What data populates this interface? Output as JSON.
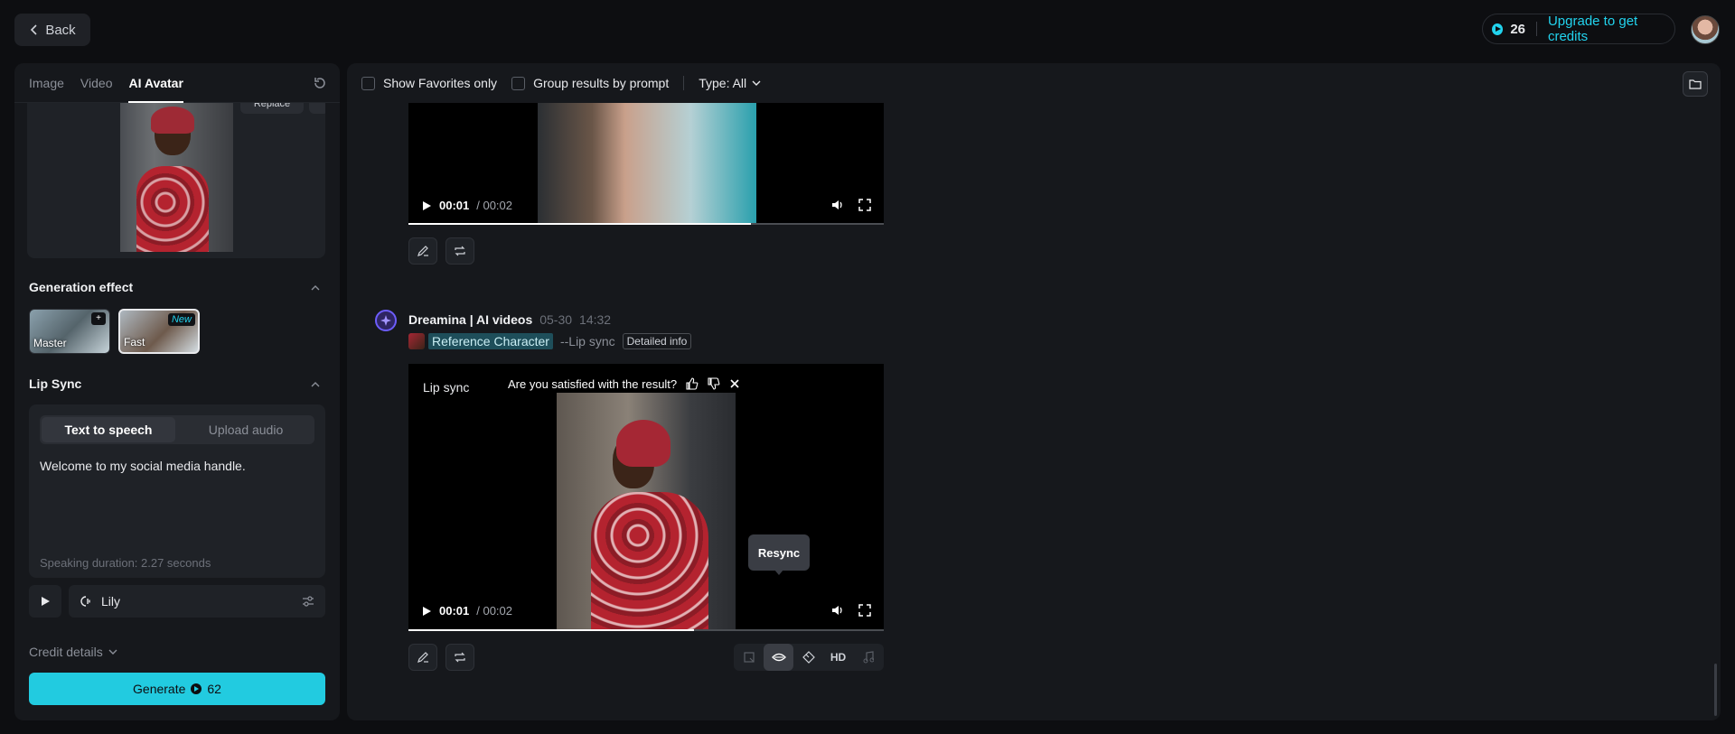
{
  "top": {
    "back_label": "Back",
    "credits": "26",
    "upgrade_label": "Upgrade to get credits"
  },
  "left": {
    "tabs": [
      {
        "label": "Image"
      },
      {
        "label": "Video"
      },
      {
        "label": "AI Avatar"
      }
    ],
    "replace_label": "Replace",
    "generation_effect": {
      "title": "Generation effect",
      "options": [
        {
          "label": "Master",
          "badge": "+"
        },
        {
          "label": "Fast",
          "badge": "New"
        }
      ]
    },
    "lip_sync": {
      "title": "Lip Sync",
      "modes": [
        {
          "label": "Text to speech"
        },
        {
          "label": "Upload audio"
        }
      ],
      "text": "Welcome to my social media handle.",
      "duration": "Speaking duration: 2.27 seconds"
    },
    "voice": "Lily",
    "credit_details_label": "Credit details",
    "generate_label": "Generate",
    "generate_cost": "62"
  },
  "main": {
    "toolbar": {
      "favorites_label": "Show Favorites only",
      "group_label": "Group results by prompt",
      "type_label": "Type: All"
    },
    "video1": {
      "current": "00:01",
      "total": "/ 00:02",
      "progress": 0.72
    },
    "result": {
      "author": "Dreamina | AI videos",
      "date": "05-30",
      "time": "14:32",
      "ref_label": "Reference Character",
      "prompt_tail": "--Lip sync",
      "detail_label": "Detailed info"
    },
    "video2": {
      "label": "Lip sync",
      "question": "Are you satisfied with the result?",
      "current": "00:01",
      "total": "/ 00:02",
      "progress": 0.6
    },
    "tooltip": "Resync",
    "hd_label": "HD"
  },
  "colors": {
    "accent": "#22cbe0",
    "panel": "#16181c",
    "background": "#0d0e11"
  }
}
